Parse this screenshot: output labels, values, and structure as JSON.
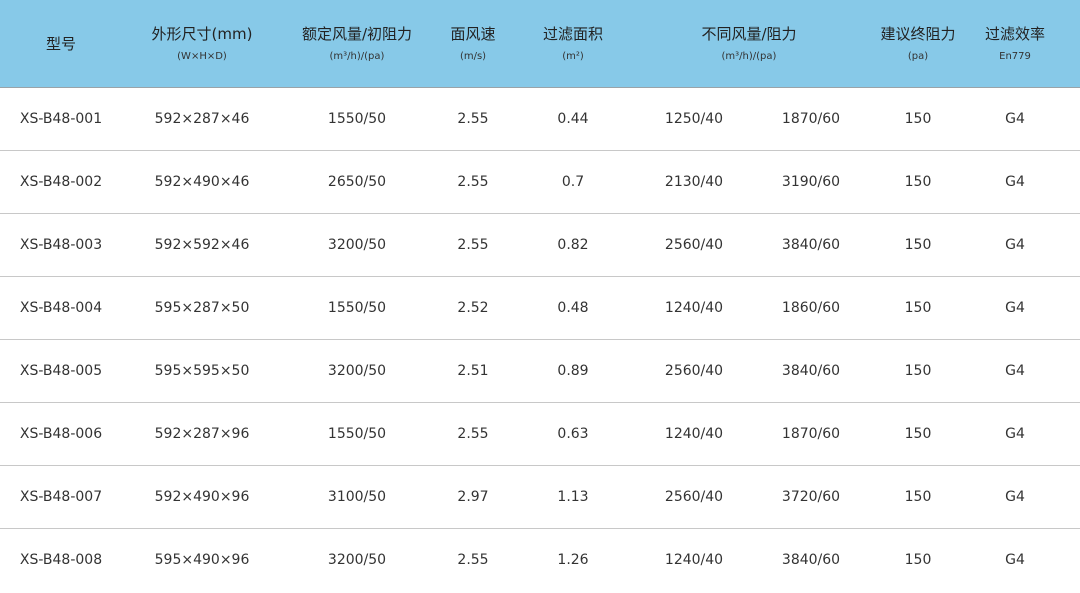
{
  "header": {
    "model": "型号",
    "size": "外形尺寸(mm)",
    "size_sub": "(W×H×D)",
    "rated": "额定风量/初阻力",
    "rated_sub": "(m³/h)/(pa)",
    "speed": "面风速",
    "speed_sub": "(m/s)",
    "area": "过滤面积",
    "area_sub": "(m²)",
    "diff": "不同风量/阻力",
    "diff_sub": "(m³/h)/(pa)",
    "final": "建议终阻力",
    "final_sub": "(pa)",
    "eff": "过滤效率",
    "eff_sub": "En779"
  },
  "rows": [
    {
      "model": "XS-B48-001",
      "size": "592×287×46",
      "rated": "1550/50",
      "speed": "2.55",
      "area": "0.44",
      "flow_a": "1250/40",
      "flow_b": "1870/60",
      "final": "150",
      "eff": "G4"
    },
    {
      "model": "XS-B48-002",
      "size": "592×490×46",
      "rated": "2650/50",
      "speed": "2.55",
      "area": "0.7",
      "flow_a": "2130/40",
      "flow_b": "3190/60",
      "final": "150",
      "eff": "G4"
    },
    {
      "model": "XS-B48-003",
      "size": "592×592×46",
      "rated": "3200/50",
      "speed": "2.55",
      "area": "0.82",
      "flow_a": "2560/40",
      "flow_b": "3840/60",
      "final": "150",
      "eff": "G4"
    },
    {
      "model": "XS-B48-004",
      "size": "595×287×50",
      "rated": "1550/50",
      "speed": "2.52",
      "area": "0.48",
      "flow_a": "1240/40",
      "flow_b": "1860/60",
      "final": "150",
      "eff": "G4"
    },
    {
      "model": "XS-B48-005",
      "size": "595×595×50",
      "rated": "3200/50",
      "speed": "2.51",
      "area": "0.89",
      "flow_a": "2560/40",
      "flow_b": "3840/60",
      "final": "150",
      "eff": "G4"
    },
    {
      "model": "XS-B48-006",
      "size": "592×287×96",
      "rated": "1550/50",
      "speed": "2.55",
      "area": "0.63",
      "flow_a": "1240/40",
      "flow_b": "1870/60",
      "final": "150",
      "eff": "G4"
    },
    {
      "model": "XS-B48-007",
      "size": "592×490×96",
      "rated": "3100/50",
      "speed": "2.97",
      "area": "1.13",
      "flow_a": "2560/40",
      "flow_b": "3720/60",
      "final": "150",
      "eff": "G4"
    },
    {
      "model": "XS-B48-008",
      "size": "595×490×96",
      "rated": "3200/50",
      "speed": "2.55",
      "area": "1.26",
      "flow_a": "1240/40",
      "flow_b": "3840/60",
      "final": "150",
      "eff": "G4"
    }
  ]
}
